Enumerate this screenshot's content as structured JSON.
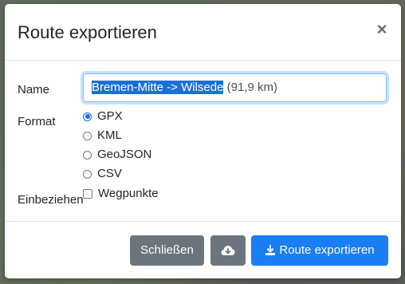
{
  "dialog": {
    "title": "Route exportieren",
    "close_symbol": "×"
  },
  "form": {
    "name_label": "Name",
    "name_value_selected": "Bremen-Mitte -> Wilsede",
    "name_value_rest": " (91,9 km)",
    "format_label": "Format",
    "formats": [
      {
        "label": "GPX",
        "checked": true
      },
      {
        "label": "KML",
        "checked": false
      },
      {
        "label": "GeoJSON",
        "checked": false
      },
      {
        "label": "CSV",
        "checked": false
      }
    ],
    "include_label": "Einbeziehen",
    "include_option": {
      "label": "Wegpunkte",
      "checked": false
    }
  },
  "footer": {
    "close_label": "Schließen",
    "cloud_icon": "cloud-download-icon",
    "export_label": "Route exportieren",
    "export_icon": "download-icon"
  },
  "colors": {
    "primary": "#1a7ef5",
    "secondary": "#6c757d",
    "selection": "#1d6fd8"
  }
}
